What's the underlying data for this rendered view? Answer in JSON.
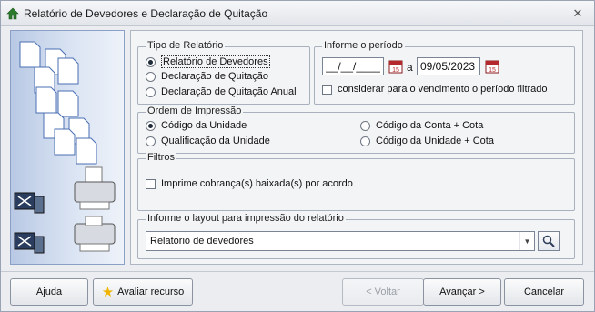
{
  "window": {
    "title": "Relatório de Devedores e Declaração de Quitação"
  },
  "report_type": {
    "legend": "Tipo de Relatório",
    "options": [
      {
        "label": "Relatório de Devedores",
        "selected": true
      },
      {
        "label": "Declaração de Quitação",
        "selected": false
      },
      {
        "label": "Declaração de Quitação Anual",
        "selected": false
      }
    ]
  },
  "period": {
    "legend": "Informe o período",
    "start_value": "__/__/____",
    "separator": "a",
    "end_value": "09/05/2023",
    "filter_checkbox_label": "considerar para o vencimento o período filtrado",
    "filter_checked": false
  },
  "print_order": {
    "legend": "Ordem de Impressão",
    "options": [
      {
        "label": "Código da Unidade",
        "selected": true
      },
      {
        "label": "Qualificação da Unidade",
        "selected": false
      },
      {
        "label": "Código da Conta + Cota",
        "selected": false
      },
      {
        "label": "Código da Unidade + Cota",
        "selected": false
      }
    ]
  },
  "filters": {
    "legend": "Filtros",
    "checkbox_label": "Imprime cobrança(s) baixada(s) por acordo",
    "checked": false
  },
  "layout": {
    "legend": "Informe o layout para impressão do relatório",
    "selected": "Relatorio de devedores"
  },
  "buttons": {
    "help": "Ajuda",
    "rate": "Avaliar recurso",
    "back": "< Voltar",
    "next": "Avançar >",
    "cancel": "Cancelar"
  },
  "colors": {
    "accent": "#2c7a2c",
    "calendar_red": "#b3282d",
    "star": "#f0b400"
  }
}
